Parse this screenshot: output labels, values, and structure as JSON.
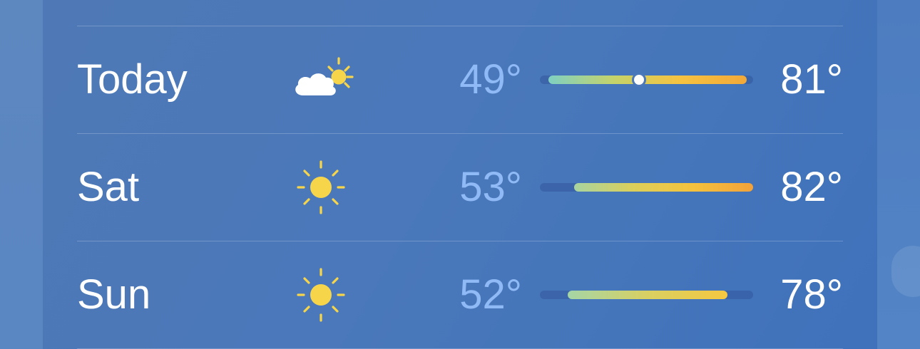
{
  "scale": {
    "min": 49,
    "max": 82
  },
  "forecast": [
    {
      "day": "Today",
      "icon": "partly-cloudy-icon",
      "low": "49°",
      "high": "81°",
      "low_value": 49,
      "high_value": 81,
      "current_value": 63,
      "colors": [
        "#7fd0c2",
        "#c6d36a",
        "#f6c240",
        "#f2a93a"
      ]
    },
    {
      "day": "Sat",
      "icon": "sun-icon",
      "low": "53°",
      "high": "82°",
      "low_value": 53,
      "high_value": 82,
      "colors": [
        "#a8d4a0",
        "#dccf5a",
        "#f5c23d",
        "#f2a23a"
      ]
    },
    {
      "day": "Sun",
      "icon": "sun-icon",
      "low": "52°",
      "high": "78°",
      "low_value": 52,
      "high_value": 78,
      "colors": [
        "#a5d5a6",
        "#d9d062",
        "#f5c840"
      ]
    }
  ],
  "colors": {
    "low_text": "#8fbaf5",
    "high_text": "#ffffff",
    "sun": "#f7d54a"
  }
}
